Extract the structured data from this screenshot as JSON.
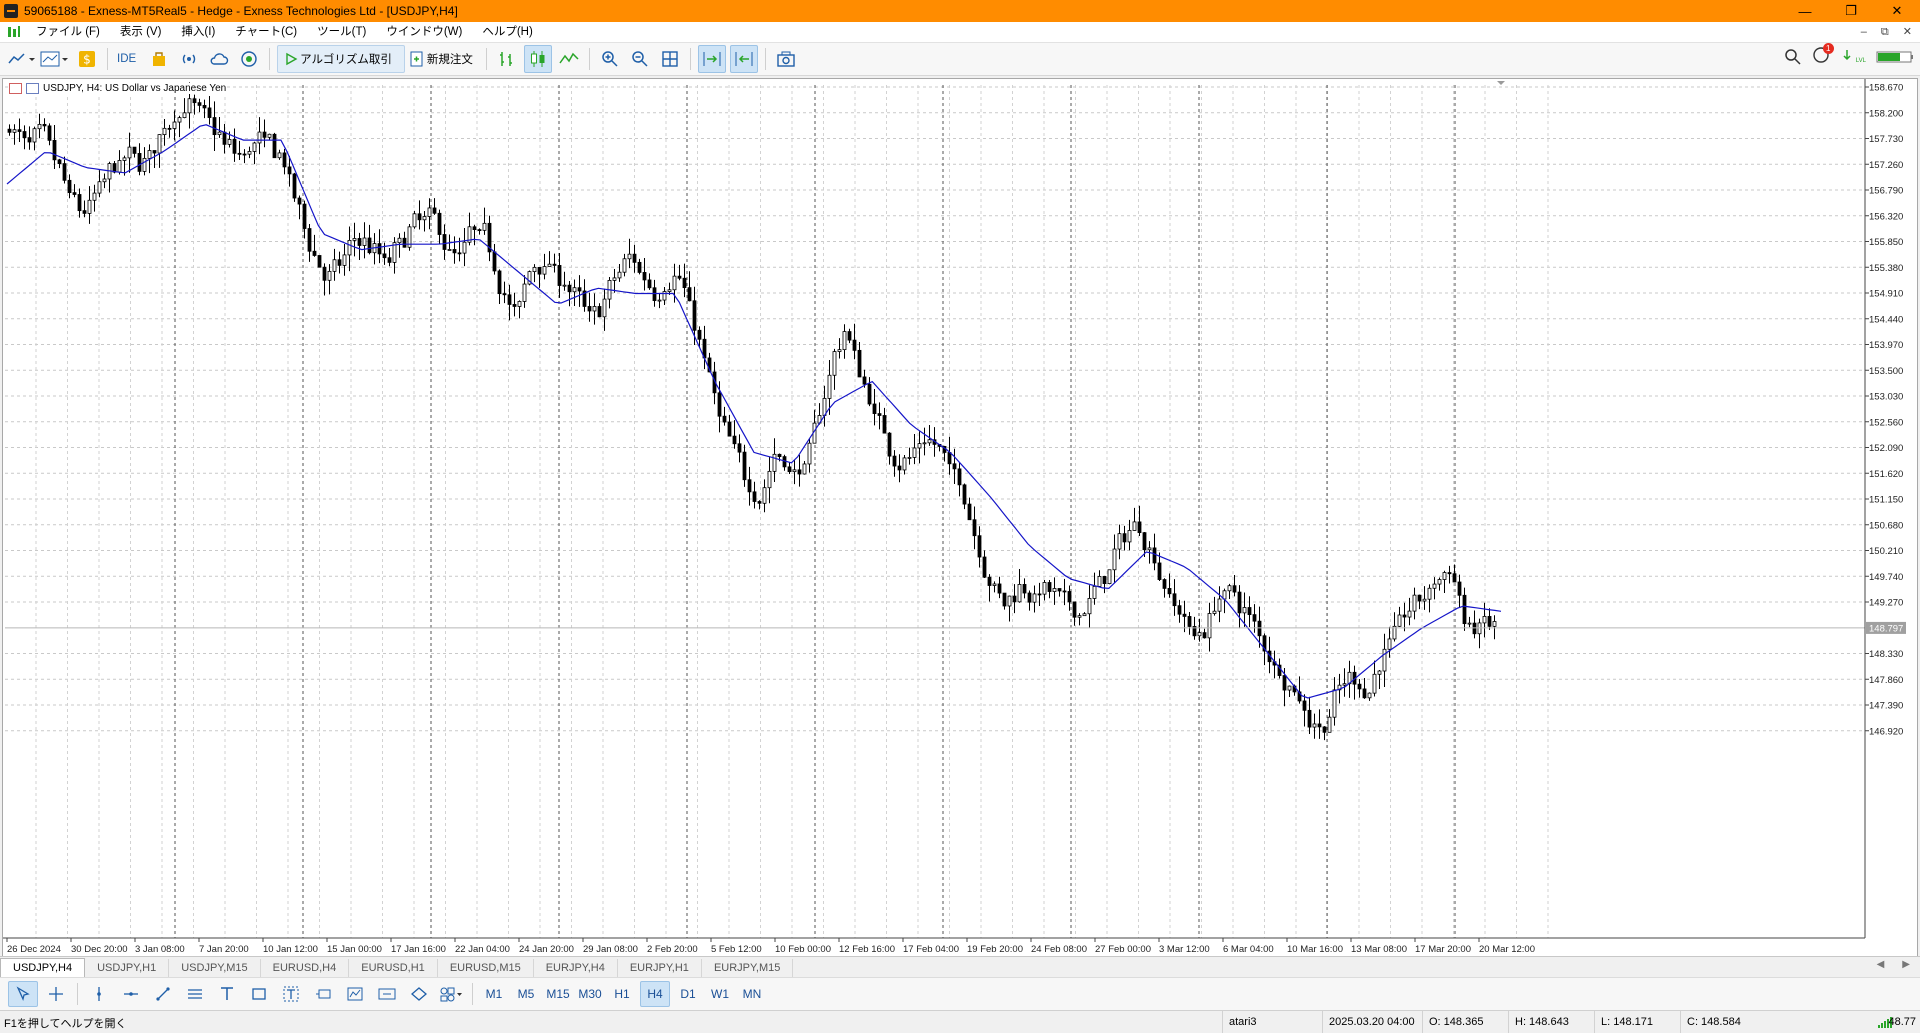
{
  "window": {
    "title": "59065188 - Exness-MT5Real5 - Hedge - Exness Technologies Ltd - [USDJPY,H4]",
    "controls": [
      "—",
      "❐",
      "✕"
    ]
  },
  "menu": {
    "items": [
      "ファイル (F)",
      "表示 (V)",
      "挿入(I)",
      "チャート(C)",
      "ツール(T)",
      "ウインドウ(W)",
      "ヘルプ(H)"
    ],
    "mdi_controls": [
      "–",
      "⧉",
      "✕"
    ]
  },
  "toolbar": {
    "ide_label": "IDE",
    "algo_label": "アルゴリズム取引",
    "new_order_label": "新規注文",
    "notification_count": "1",
    "lvl_label": "LVL"
  },
  "chart": {
    "symbol_title": "USDJPY, H4:  US Dollar vs Japanese Yen",
    "current_price": "148.797",
    "colors": {
      "candle": "#000000",
      "ma": "#1515c8",
      "grid": "#c9c9c9",
      "price_tag": "#a0a0a0"
    },
    "price_labels": [
      "158.670",
      "158.200",
      "157.730",
      "157.260",
      "156.790",
      "156.320",
      "155.850",
      "155.380",
      "154.910",
      "154.440",
      "153.970",
      "153.500",
      "153.030",
      "152.560",
      "152.090",
      "151.620",
      "151.150",
      "150.680",
      "150.210",
      "149.740",
      "149.270",
      "148.330",
      "147.860",
      "147.390",
      "146.920"
    ],
    "time_labels": [
      "26 Dec 2024",
      "30 Dec 20:00",
      "3 Jan 08:00",
      "7 Jan 20:00",
      "10 Jan 12:00",
      "15 Jan 00:00",
      "17 Jan 16:00",
      "22 Jan 04:00",
      "24 Jan 20:00",
      "29 Jan 08:00",
      "2 Feb 20:00",
      "5 Feb 12:00",
      "10 Feb 00:00",
      "12 Feb 16:00",
      "17 Feb 04:00",
      "19 Feb 20:00",
      "24 Feb 08:00",
      "27 Feb 00:00",
      "3 Mar 12:00",
      "6 Mar 04:00",
      "10 Mar 16:00",
      "13 Mar 08:00",
      "17 Mar 20:00",
      "20 Mar 12:00"
    ]
  },
  "chart_data": {
    "type": "line",
    "title": "USDJPY, H4:  US Dollar vs Japanese Yen",
    "x_range": [
      "26 Dec 2024",
      "20 Mar 12:00"
    ],
    "ylim": [
      146.6,
      158.95
    ],
    "series": [
      {
        "values": [
          157.9,
          157.6,
          157.8,
          157.3,
          156.6,
          156.3,
          156.8,
          157.2,
          157.4,
          157.3,
          157.6,
          158.1,
          158.4,
          158.2,
          157.9,
          157.5,
          157.4,
          157.7,
          157.6,
          157.2,
          156.2,
          155.6,
          155.1,
          155.5,
          156.0,
          155.7,
          155.4,
          155.9,
          156.2,
          156.4,
          155.8,
          155.5,
          156.1,
          155.9,
          155.0,
          154.3,
          155.6,
          155.5,
          155.2,
          154.9,
          154.4,
          154.7,
          155.3,
          155.6,
          155.1,
          154.9,
          155.4,
          154.6,
          153.7,
          152.6,
          152.0,
          151.4,
          151.2,
          152.1,
          151.6,
          151.7,
          152.7,
          153.9,
          154.3,
          153.2,
          152.6,
          152.0,
          151.8,
          152.1,
          152.2,
          151.7,
          151.3,
          150.3,
          149.5,
          149.2,
          149.7,
          149.4,
          149.5,
          149.2,
          149.0,
          149.4,
          149.9,
          150.4,
          150.8,
          150.2,
          149.5,
          149.1,
          148.6,
          148.9,
          149.6,
          149.3,
          148.9,
          148.4,
          148.0,
          147.6,
          147.1,
          146.9,
          147.7,
          147.9,
          147.6,
          148.3,
          148.8,
          149.2,
          149.4,
          149.8,
          149.8,
          148.6,
          148.9,
          148.8
        ]
      },
      {
        "name": "MA",
        "values": [
          156.9,
          157.5,
          157.2,
          157.1,
          157.5,
          158.0,
          157.7,
          157.7,
          156.0,
          155.7,
          155.8,
          155.8,
          155.9,
          155.3,
          154.7,
          155.0,
          154.9,
          154.9,
          153.3,
          152.0,
          151.8,
          152.9,
          153.3,
          152.5,
          152.0,
          151.2,
          150.3,
          149.7,
          149.5,
          150.2,
          149.9,
          149.3,
          148.4,
          147.5,
          147.7,
          148.3,
          148.8,
          149.2,
          149.1
        ]
      }
    ]
  },
  "tabs": [
    "USDJPY,H4",
    "USDJPY,H1",
    "USDJPY,M15",
    "EURUSD,H4",
    "EURUSD,H1",
    "EURUSD,M15",
    "EURJPY,H4",
    "EURJPY,H1",
    "EURJPY,M15"
  ],
  "timeframes": [
    "M1",
    "M5",
    "M15",
    "M30",
    "H1",
    "H4",
    "D1",
    "W1",
    "MN"
  ],
  "status": {
    "help": "F1を押してヘルプを開く",
    "profile": "atari3",
    "datetime": "2025.03.20 04:00",
    "open": "O: 148.365",
    "high": "H: 148.643",
    "low": "L: 148.171",
    "close": "C: 148.584",
    "ping": "48.77"
  }
}
